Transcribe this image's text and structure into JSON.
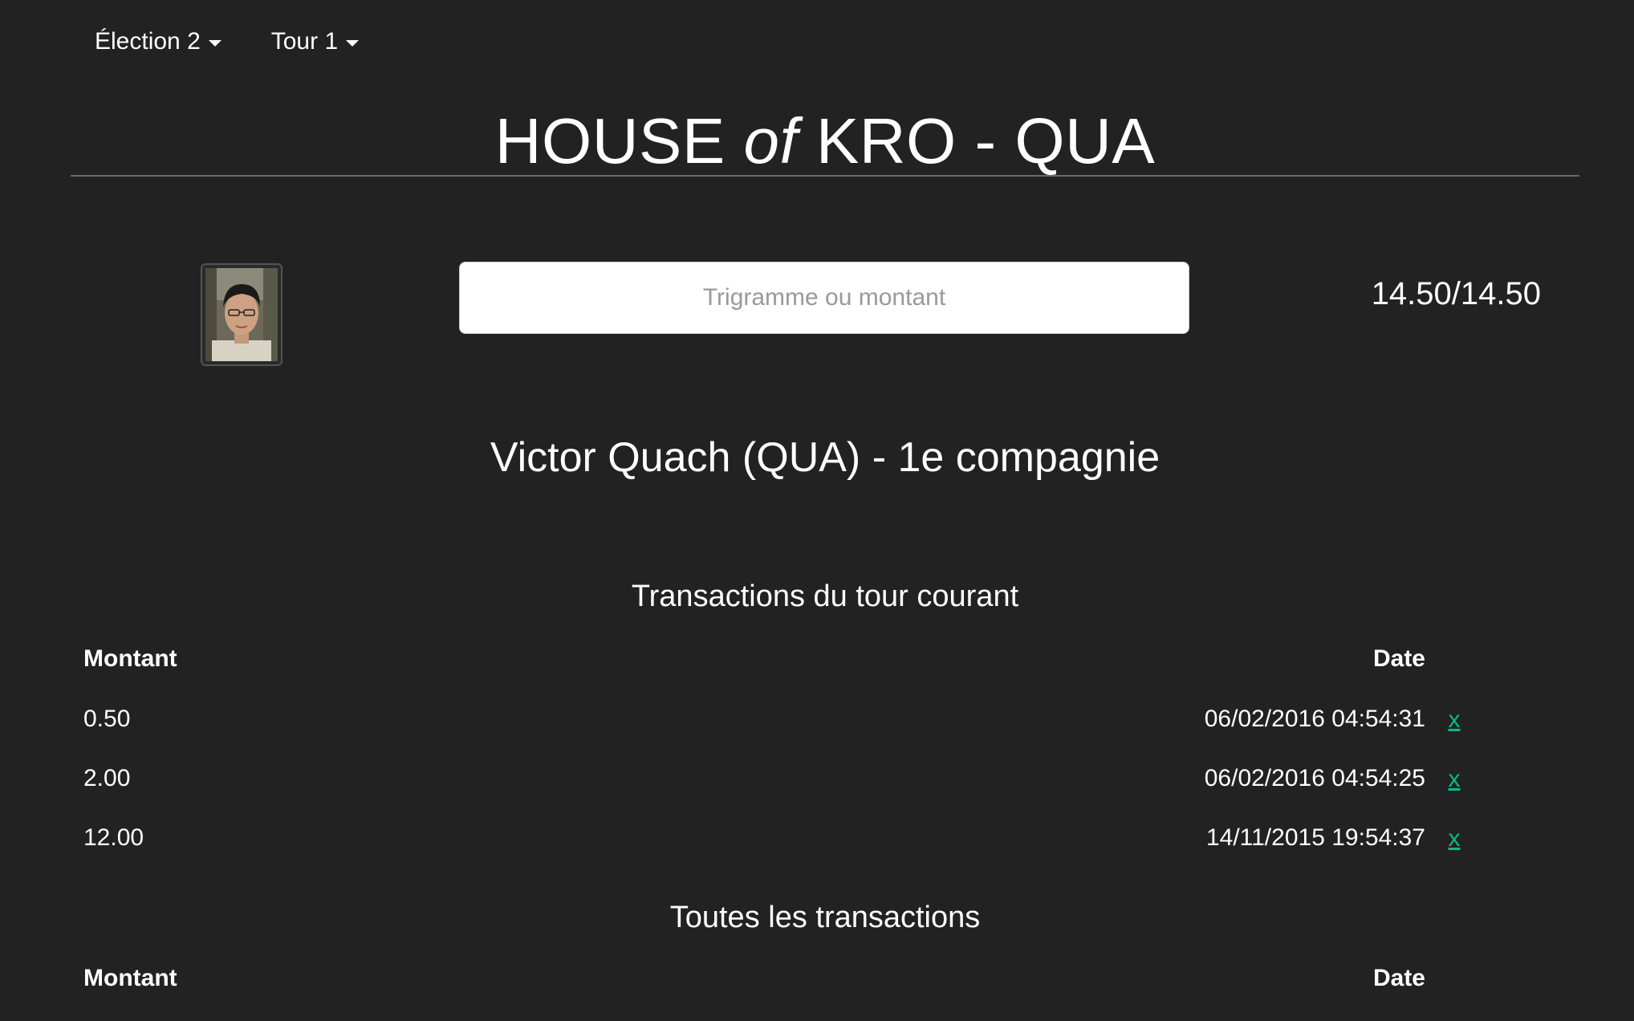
{
  "navbar": {
    "election_label": "Élection 2",
    "round_label": "Tour 1"
  },
  "header": {
    "title_part1": "HOUSE ",
    "title_of": "of",
    "title_part2": " KRO - QUA"
  },
  "search": {
    "placeholder": "Trigramme ou montant",
    "value": ""
  },
  "balance": "14.50/14.50",
  "customer": {
    "name": "Victor Quach (QUA) - 1e compagnie"
  },
  "current_round": {
    "title": "Transactions du tour courant",
    "columns": {
      "amount": "Montant",
      "date": "Date"
    },
    "rows": [
      {
        "amount": "0.50",
        "date": "06/02/2016 04:54:31",
        "delete": "x"
      },
      {
        "amount": "2.00",
        "date": "06/02/2016 04:54:25",
        "delete": "x"
      },
      {
        "amount": "12.00",
        "date": "14/11/2015 19:54:37",
        "delete": "x"
      }
    ]
  },
  "all_transactions": {
    "title": "Toutes les transactions",
    "columns": {
      "amount": "Montant",
      "date": "Date"
    }
  },
  "colors": {
    "background": "#222222",
    "link": "#00bc8c",
    "text": "#ffffff"
  }
}
